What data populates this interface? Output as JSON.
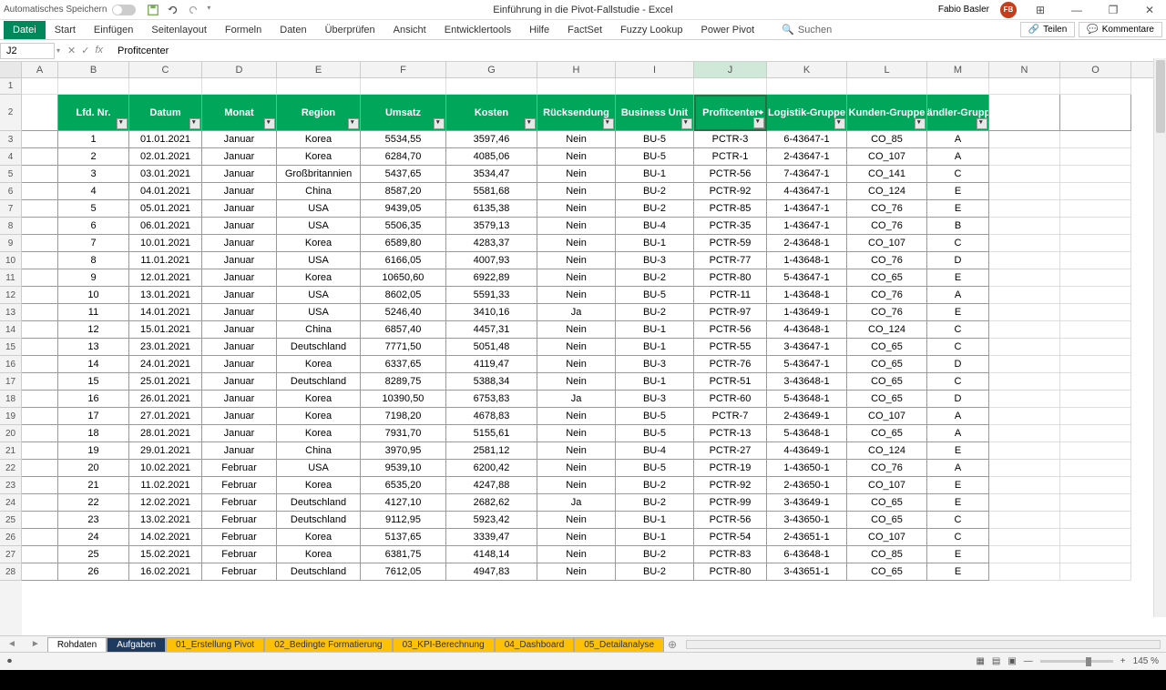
{
  "titlebar": {
    "autosave_label": "Automatisches Speichern",
    "title": "Einführung in die Pivot-Fallstudie - Excel",
    "username": "Fabio Basler",
    "avatar_initials": "FB"
  },
  "ribbon": {
    "tabs": [
      "Datei",
      "Start",
      "Einfügen",
      "Seitenlayout",
      "Formeln",
      "Daten",
      "Überprüfen",
      "Ansicht",
      "Entwicklertools",
      "Hilfe",
      "FactSet",
      "Fuzzy Lookup",
      "Power Pivot"
    ],
    "search_placeholder": "Suchen",
    "share": "Teilen",
    "comments": "Kommentare"
  },
  "formulabar": {
    "cell_ref": "J2",
    "formula_value": "Profitcenter"
  },
  "columns": [
    "A",
    "B",
    "C",
    "D",
    "E",
    "F",
    "G",
    "H",
    "I",
    "J",
    "K",
    "L",
    "M",
    "N",
    "O"
  ],
  "selected_column": "J",
  "headers": [
    "Lfd. Nr.",
    "Datum",
    "Monat",
    "Region",
    "Umsatz",
    "Kosten",
    "Rücksendung",
    "Business Unit",
    "Profitcenter",
    "Logistik-Gruppe",
    "Kunden-Gruppe",
    "Händler-Gruppe"
  ],
  "rows": [
    {
      "n": 1,
      "d": "01.01.2021",
      "m": "Januar",
      "r": "Korea",
      "u": "5534,55",
      "k": "3597,46",
      "rs": "Nein",
      "bu": "BU-5",
      "pc": "PCTR-3",
      "lg": "6-43647-1",
      "kg": "CO_85",
      "hg": "A"
    },
    {
      "n": 2,
      "d": "02.01.2021",
      "m": "Januar",
      "r": "Korea",
      "u": "6284,70",
      "k": "4085,06",
      "rs": "Nein",
      "bu": "BU-5",
      "pc": "PCTR-1",
      "lg": "2-43647-1",
      "kg": "CO_107",
      "hg": "A"
    },
    {
      "n": 3,
      "d": "03.01.2021",
      "m": "Januar",
      "r": "Großbritannien",
      "u": "5437,65",
      "k": "3534,47",
      "rs": "Nein",
      "bu": "BU-1",
      "pc": "PCTR-56",
      "lg": "7-43647-1",
      "kg": "CO_141",
      "hg": "C"
    },
    {
      "n": 4,
      "d": "04.01.2021",
      "m": "Januar",
      "r": "China",
      "u": "8587,20",
      "k": "5581,68",
      "rs": "Nein",
      "bu": "BU-2",
      "pc": "PCTR-92",
      "lg": "4-43647-1",
      "kg": "CO_124",
      "hg": "E"
    },
    {
      "n": 5,
      "d": "05.01.2021",
      "m": "Januar",
      "r": "USA",
      "u": "9439,05",
      "k": "6135,38",
      "rs": "Nein",
      "bu": "BU-2",
      "pc": "PCTR-85",
      "lg": "1-43647-1",
      "kg": "CO_76",
      "hg": "E"
    },
    {
      "n": 6,
      "d": "06.01.2021",
      "m": "Januar",
      "r": "USA",
      "u": "5506,35",
      "k": "3579,13",
      "rs": "Nein",
      "bu": "BU-4",
      "pc": "PCTR-35",
      "lg": "1-43647-1",
      "kg": "CO_76",
      "hg": "B"
    },
    {
      "n": 7,
      "d": "10.01.2021",
      "m": "Januar",
      "r": "Korea",
      "u": "6589,80",
      "k": "4283,37",
      "rs": "Nein",
      "bu": "BU-1",
      "pc": "PCTR-59",
      "lg": "2-43648-1",
      "kg": "CO_107",
      "hg": "C"
    },
    {
      "n": 8,
      "d": "11.01.2021",
      "m": "Januar",
      "r": "USA",
      "u": "6166,05",
      "k": "4007,93",
      "rs": "Nein",
      "bu": "BU-3",
      "pc": "PCTR-77",
      "lg": "1-43648-1",
      "kg": "CO_76",
      "hg": "D"
    },
    {
      "n": 9,
      "d": "12.01.2021",
      "m": "Januar",
      "r": "Korea",
      "u": "10650,60",
      "k": "6922,89",
      "rs": "Nein",
      "bu": "BU-2",
      "pc": "PCTR-80",
      "lg": "5-43647-1",
      "kg": "CO_65",
      "hg": "E"
    },
    {
      "n": 10,
      "d": "13.01.2021",
      "m": "Januar",
      "r": "USA",
      "u": "8602,05",
      "k": "5591,33",
      "rs": "Nein",
      "bu": "BU-5",
      "pc": "PCTR-11",
      "lg": "1-43648-1",
      "kg": "CO_76",
      "hg": "A"
    },
    {
      "n": 11,
      "d": "14.01.2021",
      "m": "Januar",
      "r": "USA",
      "u": "5246,40",
      "k": "3410,16",
      "rs": "Ja",
      "bu": "BU-2",
      "pc": "PCTR-97",
      "lg": "1-43649-1",
      "kg": "CO_76",
      "hg": "E"
    },
    {
      "n": 12,
      "d": "15.01.2021",
      "m": "Januar",
      "r": "China",
      "u": "6857,40",
      "k": "4457,31",
      "rs": "Nein",
      "bu": "BU-1",
      "pc": "PCTR-56",
      "lg": "4-43648-1",
      "kg": "CO_124",
      "hg": "C"
    },
    {
      "n": 13,
      "d": "23.01.2021",
      "m": "Januar",
      "r": "Deutschland",
      "u": "7771,50",
      "k": "5051,48",
      "rs": "Nein",
      "bu": "BU-1",
      "pc": "PCTR-55",
      "lg": "3-43647-1",
      "kg": "CO_65",
      "hg": "C"
    },
    {
      "n": 14,
      "d": "24.01.2021",
      "m": "Januar",
      "r": "Korea",
      "u": "6337,65",
      "k": "4119,47",
      "rs": "Nein",
      "bu": "BU-3",
      "pc": "PCTR-76",
      "lg": "5-43647-1",
      "kg": "CO_65",
      "hg": "D"
    },
    {
      "n": 15,
      "d": "25.01.2021",
      "m": "Januar",
      "r": "Deutschland",
      "u": "8289,75",
      "k": "5388,34",
      "rs": "Nein",
      "bu": "BU-1",
      "pc": "PCTR-51",
      "lg": "3-43648-1",
      "kg": "CO_65",
      "hg": "C"
    },
    {
      "n": 16,
      "d": "26.01.2021",
      "m": "Januar",
      "r": "Korea",
      "u": "10390,50",
      "k": "6753,83",
      "rs": "Ja",
      "bu": "BU-3",
      "pc": "PCTR-60",
      "lg": "5-43648-1",
      "kg": "CO_65",
      "hg": "D"
    },
    {
      "n": 17,
      "d": "27.01.2021",
      "m": "Januar",
      "r": "Korea",
      "u": "7198,20",
      "k": "4678,83",
      "rs": "Nein",
      "bu": "BU-5",
      "pc": "PCTR-7",
      "lg": "2-43649-1",
      "kg": "CO_107",
      "hg": "A"
    },
    {
      "n": 18,
      "d": "28.01.2021",
      "m": "Januar",
      "r": "Korea",
      "u": "7931,70",
      "k": "5155,61",
      "rs": "Nein",
      "bu": "BU-5",
      "pc": "PCTR-13",
      "lg": "5-43648-1",
      "kg": "CO_65",
      "hg": "A"
    },
    {
      "n": 19,
      "d": "29.01.2021",
      "m": "Januar",
      "r": "China",
      "u": "3970,95",
      "k": "2581,12",
      "rs": "Nein",
      "bu": "BU-4",
      "pc": "PCTR-27",
      "lg": "4-43649-1",
      "kg": "CO_124",
      "hg": "E"
    },
    {
      "n": 20,
      "d": "10.02.2021",
      "m": "Februar",
      "r": "USA",
      "u": "9539,10",
      "k": "6200,42",
      "rs": "Nein",
      "bu": "BU-5",
      "pc": "PCTR-19",
      "lg": "1-43650-1",
      "kg": "CO_76",
      "hg": "A"
    },
    {
      "n": 21,
      "d": "11.02.2021",
      "m": "Februar",
      "r": "Korea",
      "u": "6535,20",
      "k": "4247,88",
      "rs": "Nein",
      "bu": "BU-2",
      "pc": "PCTR-92",
      "lg": "2-43650-1",
      "kg": "CO_107",
      "hg": "E"
    },
    {
      "n": 22,
      "d": "12.02.2021",
      "m": "Februar",
      "r": "Deutschland",
      "u": "4127,10",
      "k": "2682,62",
      "rs": "Ja",
      "bu": "BU-2",
      "pc": "PCTR-99",
      "lg": "3-43649-1",
      "kg": "CO_65",
      "hg": "E"
    },
    {
      "n": 23,
      "d": "13.02.2021",
      "m": "Februar",
      "r": "Deutschland",
      "u": "9112,95",
      "k": "5923,42",
      "rs": "Nein",
      "bu": "BU-1",
      "pc": "PCTR-56",
      "lg": "3-43650-1",
      "kg": "CO_65",
      "hg": "C"
    },
    {
      "n": 24,
      "d": "14.02.2021",
      "m": "Februar",
      "r": "Korea",
      "u": "5137,65",
      "k": "3339,47",
      "rs": "Nein",
      "bu": "BU-1",
      "pc": "PCTR-54",
      "lg": "2-43651-1",
      "kg": "CO_107",
      "hg": "C"
    },
    {
      "n": 25,
      "d": "15.02.2021",
      "m": "Februar",
      "r": "Korea",
      "u": "6381,75",
      "k": "4148,14",
      "rs": "Nein",
      "bu": "BU-2",
      "pc": "PCTR-83",
      "lg": "6-43648-1",
      "kg": "CO_85",
      "hg": "E"
    },
    {
      "n": 26,
      "d": "16.02.2021",
      "m": "Februar",
      "r": "Deutschland",
      "u": "7612,05",
      "k": "4947,83",
      "rs": "Nein",
      "bu": "BU-2",
      "pc": "PCTR-80",
      "lg": "3-43651-1",
      "kg": "CO_65",
      "hg": "E"
    }
  ],
  "sheet_tabs": [
    "Rohdaten",
    "Aufgaben",
    "01_Erstellung Pivot",
    "02_Bedingte Formatierung",
    "03_KPI-Berechnung",
    "04_Dashboard",
    "05_Detailanalyse"
  ],
  "active_sheet": 1,
  "statusbar": {
    "zoom": "145 %"
  }
}
